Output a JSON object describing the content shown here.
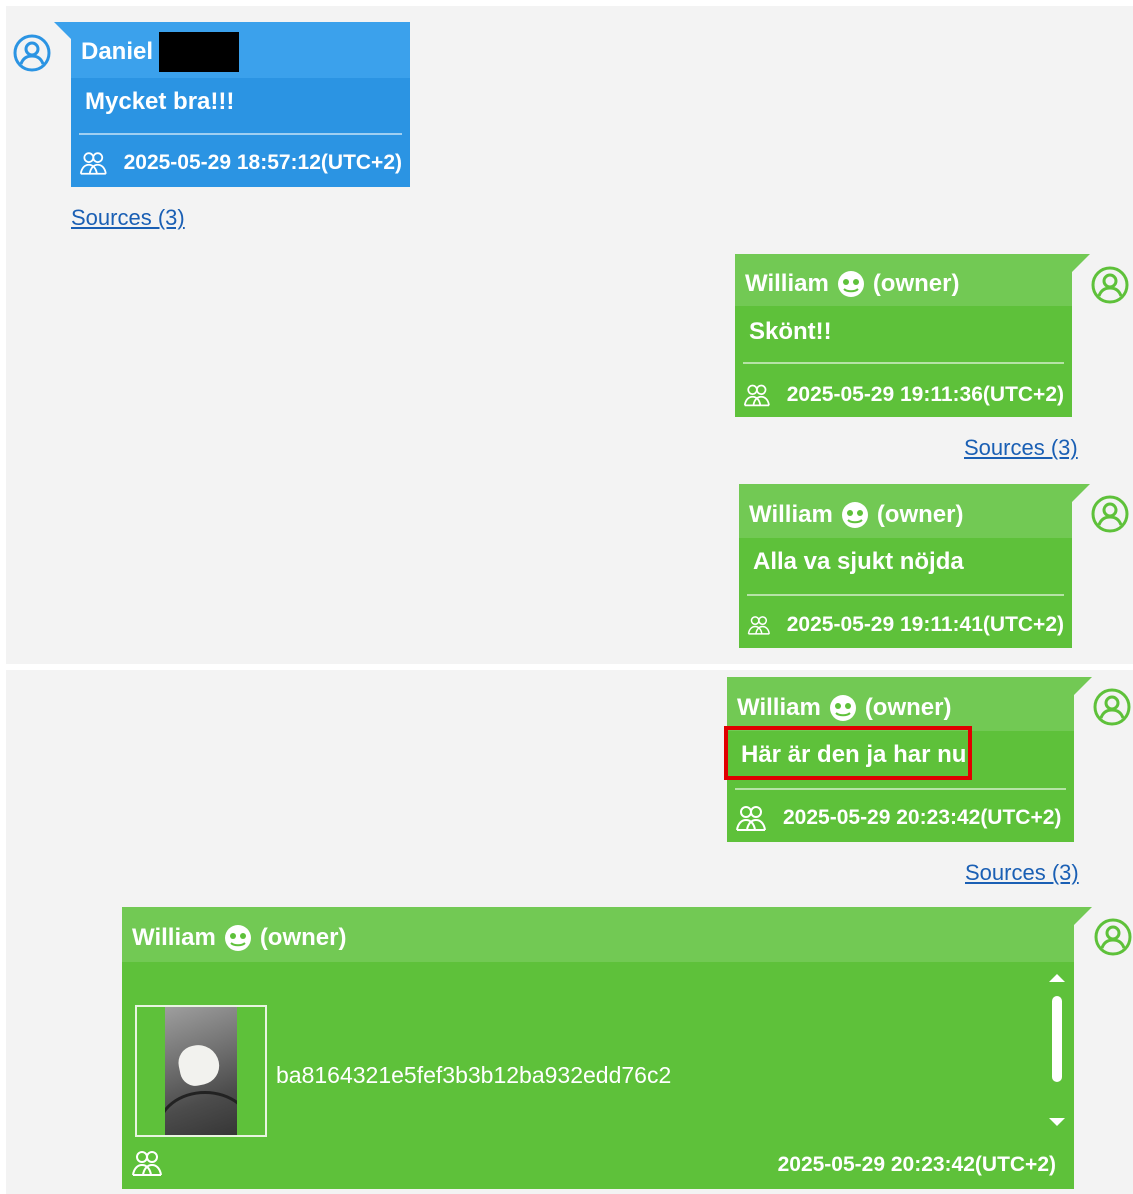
{
  "messages": [
    {
      "sender": "Daniel",
      "text": "Mycket bra!!!",
      "timestamp": "2025-05-29 18:57:12(UTC+2)",
      "sources": "Sources (3)"
    },
    {
      "sender": "William",
      "role": "(owner)",
      "text": "Skönt!!",
      "timestamp": "2025-05-29 19:11:36(UTC+2)",
      "sources": "Sources (3)"
    },
    {
      "sender": "William",
      "role": "(owner)",
      "text": "Alla va sjukt nöjda",
      "timestamp": "2025-05-29 19:11:41(UTC+2)"
    },
    {
      "sender": "William",
      "role": "(owner)",
      "text": "Här är den ja har nu",
      "timestamp": "2025-05-29 20:23:42(UTC+2)",
      "sources": "Sources (3)"
    },
    {
      "sender": "William",
      "role": "(owner)",
      "attachment": "ba8164321e5fef3b3b12ba932edd76c2",
      "timestamp": "2025-05-29 20:23:42(UTC+2)"
    }
  ],
  "colors": {
    "incoming": "#2b94e3",
    "outgoing": "#5ec13a",
    "highlight": "#e00000",
    "link": "#1a5fb4",
    "background": "#f3f3f3"
  },
  "icons": {
    "avatar": "user-circle-icon",
    "participants": "people-group-icon",
    "owner_badge": "owner-badge-icon"
  }
}
